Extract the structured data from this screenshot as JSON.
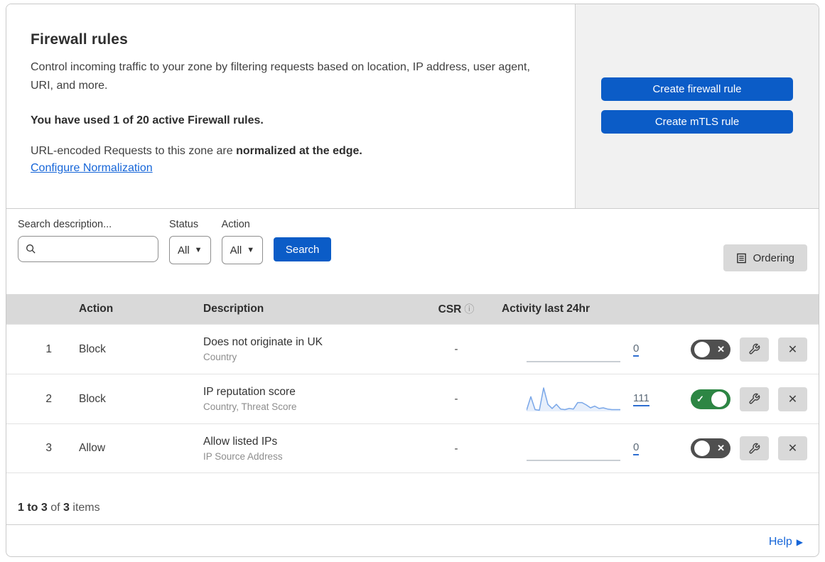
{
  "header": {
    "title": "Firewall rules",
    "description": "Control incoming traffic to your zone by filtering requests based on location, IP address, user agent, URI, and more.",
    "usage_text": "You have used 1 of 20 active Firewall rules.",
    "normalization_prefix": "URL-encoded Requests to this zone are",
    "normalization_bold": "normalized at the edge.",
    "normalization_link": "Configure Normalization"
  },
  "actions_panel": {
    "create_firewall_label": "Create firewall rule",
    "create_mtls_label": "Create mTLS rule"
  },
  "filters": {
    "search_label": "Search description...",
    "search_value": "",
    "status_label": "Status",
    "status_value": "All",
    "action_label": "Action",
    "action_value": "All",
    "search_button": "Search",
    "ordering_button": "Ordering"
  },
  "table": {
    "columns": {
      "action": "Action",
      "description": "Description",
      "csr": "CSR",
      "csr_info_icon": "ⓘ",
      "activity": "Activity last 24hr"
    },
    "rows": [
      {
        "priority": "1",
        "action": "Block",
        "description": "Does not originate in UK",
        "fields": "Country",
        "csr": "-",
        "activity_count": "0",
        "sparkline": [],
        "enabled": false
      },
      {
        "priority": "2",
        "action": "Block",
        "description": "IP reputation score",
        "fields": "Country, Threat Score",
        "csr": "-",
        "activity_count": "111",
        "sparkline": [
          2,
          25,
          3,
          2,
          40,
          12,
          5,
          12,
          4,
          3,
          5,
          4,
          15,
          15,
          11,
          6,
          9,
          5,
          6,
          4,
          3,
          3,
          3
        ],
        "enabled": true
      },
      {
        "priority": "3",
        "action": "Allow",
        "description": "Allow listed IPs",
        "fields": "IP Source Address",
        "csr": "-",
        "activity_count": "0",
        "sparkline": [],
        "enabled": false
      }
    ]
  },
  "summary": {
    "range_bold": "1 to 3",
    "of_text": "of",
    "total_bold": "3",
    "items_text": "items"
  },
  "footer": {
    "help_label": "Help"
  },
  "colors": {
    "primary_blue": "#0b5cc7",
    "link_blue": "#1565d8",
    "toggle_on_green": "#2d8644",
    "toggle_off_gray": "#4f4f4f",
    "sparkline_blue": "#7aa7e8",
    "sparkline_fill": "rgba(122,167,232,0.18)",
    "flat_line_gray": "#b7bec6",
    "table_header_gray": "#d9d9d9",
    "panel_gray": "#f1f1f1"
  }
}
